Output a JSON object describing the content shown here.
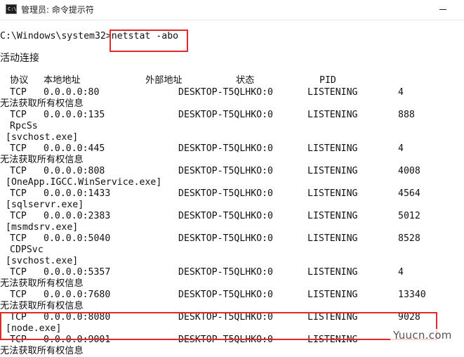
{
  "window": {
    "title": "管理员: 命令提示符",
    "icon_label": "C:\\"
  },
  "prompt": "C:\\Windows\\system32>",
  "command": "netstat -abo",
  "section_title": "活动连接",
  "headers": [
    "协议",
    "本地地址",
    "外部地址",
    "状态",
    "PID"
  ],
  "entries": [
    {
      "proto": "TCP",
      "local": "0.0.0.0:80",
      "foreign": "DESKTOP-T5QLHKO:0",
      "state": "LISTENING",
      "pid": "4",
      "info": [
        "无法获取所有权信息"
      ]
    },
    {
      "proto": "TCP",
      "local": "0.0.0.0:135",
      "foreign": "DESKTOP-T5QLHKO:0",
      "state": "LISTENING",
      "pid": "888",
      "info": [
        "RpcSs",
        "[svchost.exe]"
      ]
    },
    {
      "proto": "TCP",
      "local": "0.0.0.0:445",
      "foreign": "DESKTOP-T5QLHKO:0",
      "state": "LISTENING",
      "pid": "4",
      "info": [
        "无法获取所有权信息"
      ]
    },
    {
      "proto": "TCP",
      "local": "0.0.0.0:808",
      "foreign": "DESKTOP-T5QLHKO:0",
      "state": "LISTENING",
      "pid": "4008",
      "info": [
        "[OneApp.IGCC.WinService.exe]"
      ]
    },
    {
      "proto": "TCP",
      "local": "0.0.0.0:1433",
      "foreign": "DESKTOP-T5QLHKO:0",
      "state": "LISTENING",
      "pid": "4564",
      "info": [
        "[sqlservr.exe]"
      ]
    },
    {
      "proto": "TCP",
      "local": "0.0.0.0:2383",
      "foreign": "DESKTOP-T5QLHKO:0",
      "state": "LISTENING",
      "pid": "5012",
      "info": [
        "[msmdsrv.exe]"
      ]
    },
    {
      "proto": "TCP",
      "local": "0.0.0.0:5040",
      "foreign": "DESKTOP-T5QLHKO:0",
      "state": "LISTENING",
      "pid": "8528",
      "info": [
        "CDPSvc",
        "[svchost.exe]"
      ]
    },
    {
      "proto": "TCP",
      "local": "0.0.0.0:5357",
      "foreign": "DESKTOP-T5QLHKO:0",
      "state": "LISTENING",
      "pid": "4",
      "info": [
        "无法获取所有权信息"
      ]
    },
    {
      "proto": "TCP",
      "local": "0.0.0.0:7680",
      "foreign": "DESKTOP-T5QLHKO:0",
      "state": "LISTENING",
      "pid": "13340",
      "info": [
        "无法获取所有权信息"
      ]
    },
    {
      "proto": "TCP",
      "local": "0.0.0.0:8080",
      "foreign": "DESKTOP-T5QLHKO:0",
      "state": "LISTENING",
      "pid": "9028",
      "info": [
        "[node.exe]"
      ]
    },
    {
      "proto": "TCP",
      "local": "0.0.0.0:9001",
      "foreign": "DESKTOP-T5QLHKO:0",
      "state": "LISTENING",
      "pid": "",
      "info": [
        "无法获取所有权信息"
      ]
    }
  ],
  "watermark": "Yuucn.com",
  "colors": {
    "highlight": "#e02a2a",
    "text": "#111111",
    "background": "#ffffff"
  }
}
